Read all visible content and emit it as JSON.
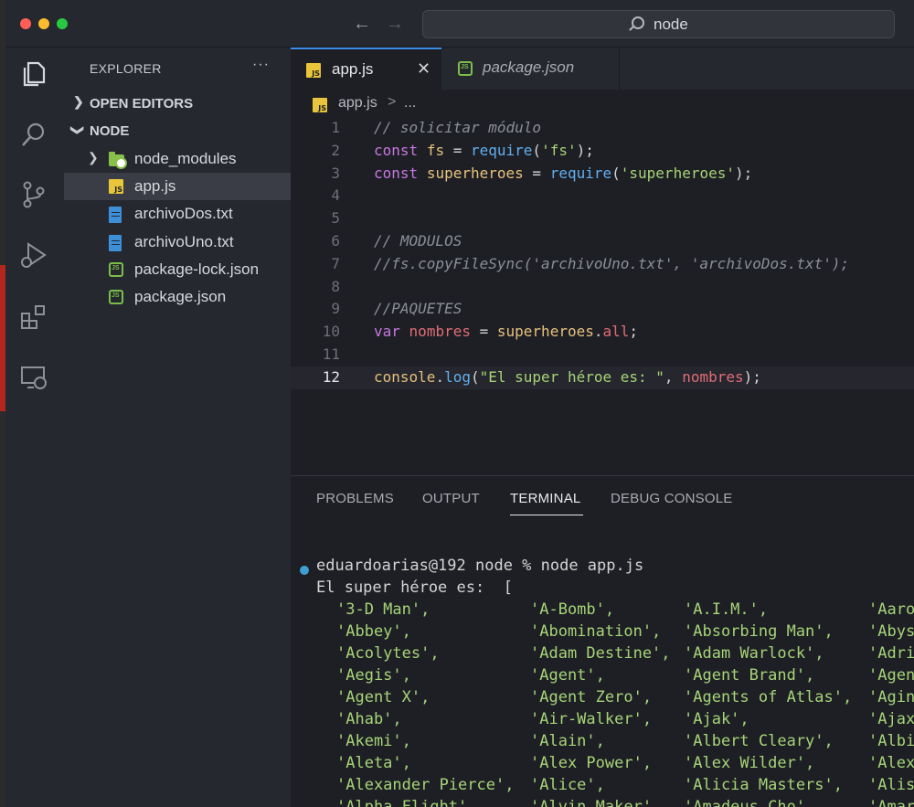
{
  "window": {
    "search_text": "node"
  },
  "activity": [
    "explorer-icon",
    "search-icon",
    "source-control-icon",
    "run-debug-icon",
    "extensions-icon",
    "remote-explorer-icon"
  ],
  "sidebar": {
    "title": "EXPLORER",
    "more": "···",
    "open_editors": "OPEN EDITORS",
    "folder": "NODE",
    "items": [
      {
        "name": "node_modules",
        "type": "folder"
      },
      {
        "name": "app.js",
        "type": "js"
      },
      {
        "name": "archivoDos.txt",
        "type": "txt"
      },
      {
        "name": "archivoUno.txt",
        "type": "txt"
      },
      {
        "name": "package-lock.json",
        "type": "json"
      },
      {
        "name": "package.json",
        "type": "json"
      }
    ]
  },
  "tabs": [
    {
      "label": "app.js"
    },
    {
      "label": "package.json"
    }
  ],
  "breadcrumb": {
    "file": "app.js",
    "sep": ">",
    "more": "..."
  },
  "code": {
    "line_numbers": [
      "1",
      "2",
      "3",
      "4",
      "5",
      "6",
      "7",
      "8",
      "9",
      "10",
      "11",
      "12"
    ],
    "l1": "// solicitar módulo",
    "l2": {
      "kw": "const",
      "name": "fs",
      "eq": " = ",
      "fn": "require",
      "open": "(",
      "str": "'fs'",
      "close": ");"
    },
    "l3": {
      "kw": "const",
      "name": "superheroes",
      "eq": " = ",
      "fn": "require",
      "open": "(",
      "str": "'superheroes'",
      "close": ");"
    },
    "l6": "// MODULOS",
    "l7": "//fs.copyFileSync('archivoUno.txt', 'archivoDos.txt');",
    "l9": "//PAQUETES",
    "l10": {
      "kw": "var",
      "name": "nombres",
      "eq": " = ",
      "obj": "superheroes",
      "dot": ".",
      "prop": "all",
      "end": ";"
    },
    "l12": {
      "obj": "console",
      "dot": ".",
      "fn": "log",
      "open": "(",
      "str": "\"El super héroe es: \"",
      "comma": ", ",
      "arg": "nombres",
      "close": ");"
    }
  },
  "panel": {
    "tabs": [
      "PROBLEMS",
      "OUTPUT",
      "TERMINAL",
      "DEBUG CONSOLE"
    ],
    "active_tab": "TERMINAL"
  },
  "terminal": {
    "prompt": "eduardoarias@192 node % node app.js",
    "output_head": "El super héroe es:  [",
    "rows": [
      [
        "'3-D Man',",
        "'A-Bomb',",
        "'A.I.M.',",
        "'Aaro"
      ],
      [
        "'Abbey',",
        "'Abomination',",
        "'Absorbing Man',",
        "'Abys"
      ],
      [
        "'Acolytes',",
        "'Adam Destine',",
        "'Adam Warlock',",
        "'Adri"
      ],
      [
        "'Aegis',",
        "'Agent',",
        "'Agent Brand',",
        "'Agen"
      ],
      [
        "'Agent X',",
        "'Agent Zero',",
        "'Agents of Atlas',",
        "'Agin"
      ],
      [
        "'Ahab',",
        "'Air-Walker',",
        "'Ajak',",
        "'Ajax"
      ],
      [
        "'Akemi',",
        "'Alain',",
        "'Albert Cleary',",
        "'Albi"
      ],
      [
        "'Aleta',",
        "'Alex Power',",
        "'Alex Wilder',",
        "'Alex"
      ],
      [
        "'Alexander Pierce',",
        "'Alice',",
        "'Alicia Masters',",
        "'Alis"
      ],
      [
        "'Alpha Flight',",
        "'Alvin Maker',",
        "'Amadeus Cho',",
        "'Amar"
      ]
    ]
  }
}
